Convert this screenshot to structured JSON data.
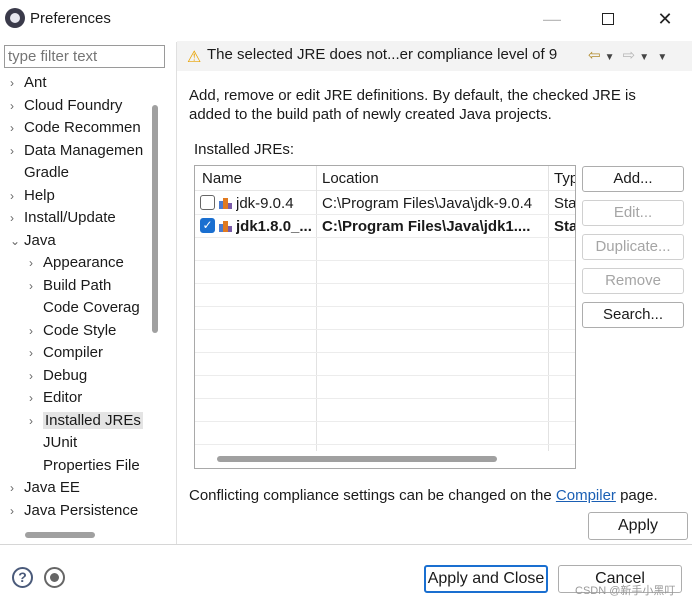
{
  "window": {
    "title": "Preferences"
  },
  "filter": {
    "placeholder": "type filter text"
  },
  "tree": {
    "items": [
      {
        "label": "Ant",
        "chev": "›"
      },
      {
        "label": "Cloud Foundry",
        "chev": "›"
      },
      {
        "label": "Code Recommen",
        "chev": "›"
      },
      {
        "label": "Data Managemen",
        "chev": "›"
      },
      {
        "label": "Gradle",
        "chev": ""
      },
      {
        "label": "Help",
        "chev": "›"
      },
      {
        "label": "Install/Update",
        "chev": "›"
      },
      {
        "label": "Java",
        "chev": "⌄"
      },
      {
        "label": "Appearance",
        "chev": "›"
      },
      {
        "label": "Build Path",
        "chev": "›"
      },
      {
        "label": "Code Coverag",
        "chev": ""
      },
      {
        "label": "Code Style",
        "chev": "›"
      },
      {
        "label": "Compiler",
        "chev": "›"
      },
      {
        "label": "Debug",
        "chev": "›"
      },
      {
        "label": "Editor",
        "chev": "›"
      },
      {
        "label": "Installed JREs",
        "chev": "›"
      },
      {
        "label": "JUnit",
        "chev": ""
      },
      {
        "label": "Properties File",
        "chev": ""
      },
      {
        "label": "Java EE",
        "chev": "›"
      },
      {
        "label": "Java Persistence",
        "chev": "›"
      }
    ]
  },
  "message": {
    "text": "The selected JRE does not...er compliance level of 9"
  },
  "description": "Add, remove or edit JRE definitions. By default, the checked JRE is added to the build path of newly created Java projects.",
  "installed_label": "Installed JREs:",
  "table": {
    "headers": [
      "Name",
      "Location",
      "Typ"
    ],
    "rows": [
      {
        "checked": false,
        "name": "jdk-9.0.4",
        "location": "C:\\Program Files\\Java\\jdk-9.0.4",
        "type": "Sta"
      },
      {
        "checked": true,
        "name": "jdk1.8.0_...",
        "location": "C:\\Program Files\\Java\\jdk1....",
        "type": "Sta"
      }
    ]
  },
  "buttons": {
    "add": "Add...",
    "edit": "Edit...",
    "duplicate": "Duplicate...",
    "remove": "Remove",
    "search": "Search..."
  },
  "conflict": {
    "text": "Conflicting compliance settings can be changed on the ",
    "link": "Compiler",
    "suffix": " page."
  },
  "apply": "Apply",
  "apply_close": "Apply and Close",
  "cancel": "Cancel",
  "watermark": "CSDN @新手小黑叮"
}
